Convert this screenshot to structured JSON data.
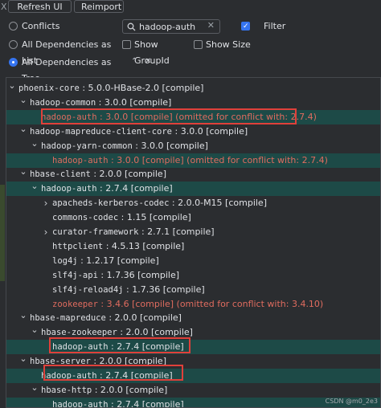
{
  "toolbar": {
    "refresh_label": "Refresh UI",
    "reimport_label": "Reimport",
    "close_glyph": "X"
  },
  "options": {
    "conflicts": "Conflicts",
    "all_deps_list": "All Dependencies as List",
    "all_deps_tree": "All Dependencies as Tree",
    "show_groupid": "Show GroupId",
    "show_size": "Show Size",
    "filter": "Filter",
    "search_value": "hadoop-auth"
  },
  "tree": [
    {
      "name": "phoenix-core",
      "info": " : 5.0.0-HBase-2.0 [compile]",
      "depth": 0,
      "arrow": "down",
      "hl": false,
      "red": false
    },
    {
      "name": "hadoop-common",
      "info": " : 3.0.0 [compile]",
      "depth": 1,
      "arrow": "down",
      "hl": false,
      "red": false
    },
    {
      "name": "hadoop-auth",
      "info": " : 3.0.0 [compile] (omitted for conflict with: 2.7.4)",
      "depth": 2,
      "arrow": "",
      "hl": true,
      "red": true
    },
    {
      "name": "hadoop-mapreduce-client-core",
      "info": " : 3.0.0 [compile]",
      "depth": 1,
      "arrow": "down",
      "hl": false,
      "red": false
    },
    {
      "name": "hadoop-yarn-common",
      "info": " : 3.0.0 [compile]",
      "depth": 2,
      "arrow": "down",
      "hl": false,
      "red": false
    },
    {
      "name": "hadoop-auth",
      "info": " : 3.0.0 [compile] (omitted for conflict with: 2.7.4)",
      "depth": 3,
      "arrow": "",
      "hl": true,
      "red": true
    },
    {
      "name": "hbase-client",
      "info": " : 2.0.0 [compile]",
      "depth": 1,
      "arrow": "down",
      "hl": false,
      "red": false
    },
    {
      "name": "hadoop-auth",
      "info": " : 2.7.4 [compile]",
      "depth": 2,
      "arrow": "down",
      "hl": true,
      "red": false
    },
    {
      "name": "apacheds-kerberos-codec",
      "info": " : 2.0.0-M15 [compile]",
      "depth": 3,
      "arrow": "right",
      "hl": false,
      "red": false
    },
    {
      "name": "commons-codec",
      "info": " : 1.15 [compile]",
      "depth": 3,
      "arrow": "",
      "hl": false,
      "red": false
    },
    {
      "name": "curator-framework",
      "info": " : 2.7.1 [compile]",
      "depth": 3,
      "arrow": "right",
      "hl": false,
      "red": false
    },
    {
      "name": "httpclient",
      "info": " : 4.5.13 [compile]",
      "depth": 3,
      "arrow": "",
      "hl": false,
      "red": false
    },
    {
      "name": "log4j",
      "info": " : 1.2.17 [compile]",
      "depth": 3,
      "arrow": "",
      "hl": false,
      "red": false
    },
    {
      "name": "slf4j-api",
      "info": " : 1.7.36 [compile]",
      "depth": 3,
      "arrow": "",
      "hl": false,
      "red": false
    },
    {
      "name": "slf4j-reload4j",
      "info": " : 1.7.36 [compile]",
      "depth": 3,
      "arrow": "",
      "hl": false,
      "red": false
    },
    {
      "name": "zookeeper",
      "info": " : 3.4.6 [compile] (omitted for conflict with: 3.4.10)",
      "depth": 3,
      "arrow": "",
      "hl": false,
      "red": true
    },
    {
      "name": "hbase-mapreduce",
      "info": " : 2.0.0 [compile]",
      "depth": 1,
      "arrow": "down",
      "hl": false,
      "red": false
    },
    {
      "name": "hbase-zookeeper",
      "info": " : 2.0.0 [compile]",
      "depth": 2,
      "arrow": "down",
      "hl": false,
      "red": false
    },
    {
      "name": "hadoop-auth",
      "info": " : 2.7.4 [compile]",
      "depth": 3,
      "arrow": "",
      "hl": true,
      "red": false
    },
    {
      "name": "hbase-server",
      "info": " : 2.0.0 [compile]",
      "depth": 1,
      "arrow": "down",
      "hl": false,
      "red": false
    },
    {
      "name": "hadoop-auth",
      "info": " : 2.7.4 [compile]",
      "depth": 2,
      "arrow": "",
      "hl": true,
      "red": false
    },
    {
      "name": "hbase-http",
      "info": " : 2.0.0 [compile]",
      "depth": 2,
      "arrow": "down",
      "hl": false,
      "red": false
    },
    {
      "name": "hadoop-auth",
      "info": " : 2.7.4 [compile]",
      "depth": 3,
      "arrow": "",
      "hl": true,
      "red": false
    }
  ],
  "watermark": "CSDN @m0_2e3",
  "colors": {
    "highlight_row": "#1d4a47",
    "conflict_text": "#e06c5f",
    "annotation_box": "#e0403a",
    "accent": "#3574f0"
  }
}
